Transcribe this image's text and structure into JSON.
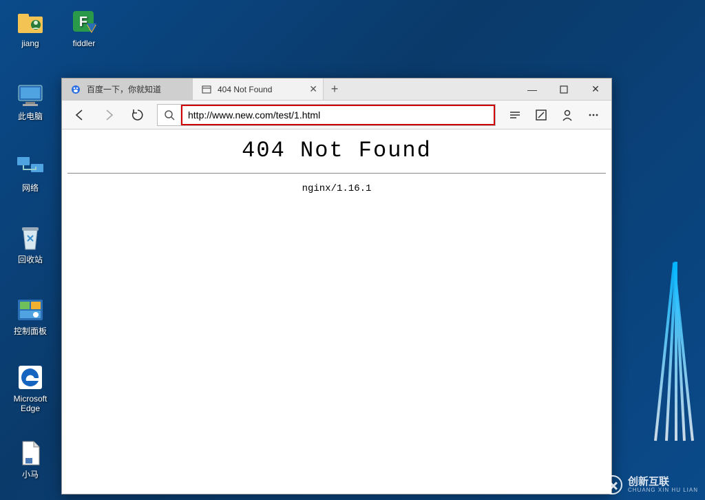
{
  "desktop": {
    "icons": [
      {
        "key": "jiang",
        "label": "jiang"
      },
      {
        "key": "fiddler",
        "label": "fiddler"
      },
      {
        "key": "this-pc",
        "label": "此电脑"
      },
      {
        "key": "network",
        "label": "网络"
      },
      {
        "key": "recycle-bin",
        "label": "回收站"
      },
      {
        "key": "control-panel",
        "label": "控制面板"
      },
      {
        "key": "edge",
        "label": "Microsoft Edge"
      },
      {
        "key": "xiaoma",
        "label": "小马"
      }
    ]
  },
  "browser": {
    "tabs": [
      {
        "title": "百度一下，你就知道",
        "active": false,
        "favicon": "baidu"
      },
      {
        "title": "404 Not Found",
        "active": true,
        "favicon": "page"
      }
    ],
    "new_tab_tooltip": "+",
    "window_controls": {
      "minimize": "—",
      "maximize": "▢",
      "close": "✕"
    },
    "address_bar": {
      "value": "http://www.new.com/test/1.html"
    },
    "page": {
      "heading": "404 Not Found",
      "server": "nginx/1.16.1"
    }
  },
  "watermark": {
    "text": "创新互联",
    "sub": "CHUANG XIN HU LIAN"
  }
}
